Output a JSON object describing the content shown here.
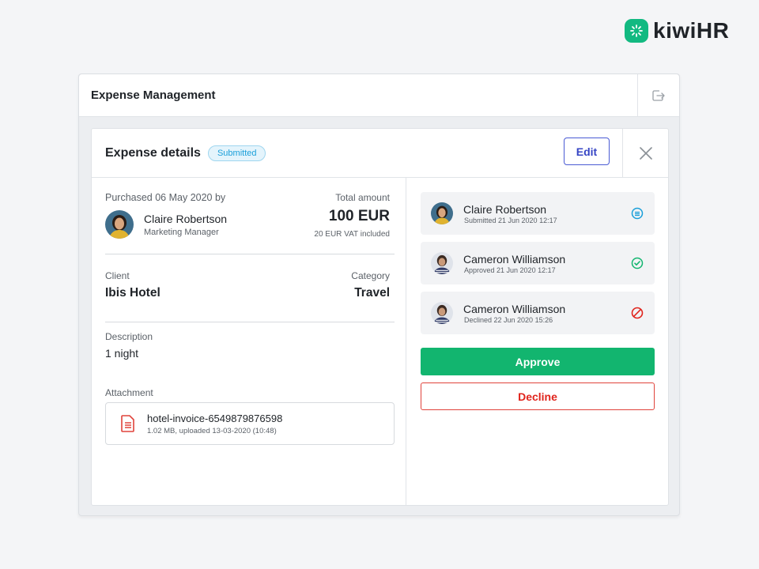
{
  "brand": {
    "name": "kiwiHR",
    "accent": "#12b981"
  },
  "window": {
    "title": "Expense Management",
    "export_icon": "export-icon"
  },
  "panel": {
    "title": "Expense details",
    "status_badge": "Submitted",
    "edit_label": "Edit",
    "close_icon": "close-icon"
  },
  "expense": {
    "purchased_label": "Purchased 06 May 2020 by",
    "buyer_name": "Claire Robertson",
    "buyer_role": "Marketing Manager",
    "total_label": "Total amount",
    "total_amount": "100 EUR",
    "vat_note": "20 EUR VAT included",
    "client_label": "Client",
    "client_value": "Ibis Hotel",
    "category_label": "Category",
    "category_value": "Travel",
    "description_label": "Description",
    "description_value": "1 night",
    "attachment_label": "Attachment",
    "attachment_name": "hotel-invoice-6549879876598",
    "attachment_meta": "1.02 MB, uploaded 13-03-2020 (10:48)"
  },
  "approvals": [
    {
      "name": "Claire Robertson",
      "meta": "Submitted 21 Jun 2020 12:17",
      "status": "submitted",
      "status_icon": "submitted-icon",
      "color": "#1a9fd9"
    },
    {
      "name": "Cameron Williamson",
      "meta": "Approved 21 Jun 2020 12:17",
      "status": "approved",
      "status_icon": "check-circle-icon",
      "color": "#12b56f"
    },
    {
      "name": "Cameron Williamson",
      "meta": "Declined 22 Jun 2020 15:26",
      "status": "declined",
      "status_icon": "prohibited-icon",
      "color": "#e0241c"
    }
  ],
  "actions": {
    "approve_label": "Approve",
    "decline_label": "Decline",
    "approve_color": "#12b56f",
    "decline_color": "#e0241c"
  }
}
